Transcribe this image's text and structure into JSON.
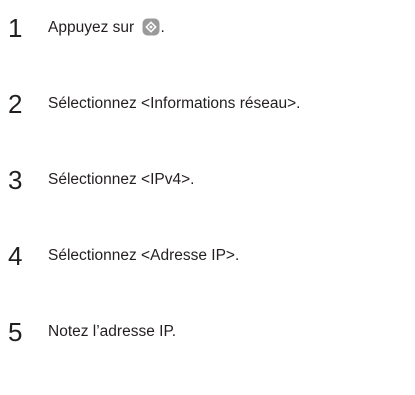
{
  "steps": [
    {
      "number": "1",
      "text_before_icon": "Appuyez sur",
      "icon": "settings-home-icon",
      "text_after_icon": "."
    },
    {
      "number": "2",
      "text": "Sélectionnez <Informations réseau>."
    },
    {
      "number": "3",
      "text": "Sélectionnez <IPv4>."
    },
    {
      "number": "4",
      "text": "Sélectionnez <Adresse IP>."
    },
    {
      "number": "5",
      "text": "Notez l’adresse IP."
    }
  ],
  "colors": {
    "text": "#231f20",
    "icon_fill": "#9a9a9a",
    "icon_inner": "#ffffff"
  }
}
